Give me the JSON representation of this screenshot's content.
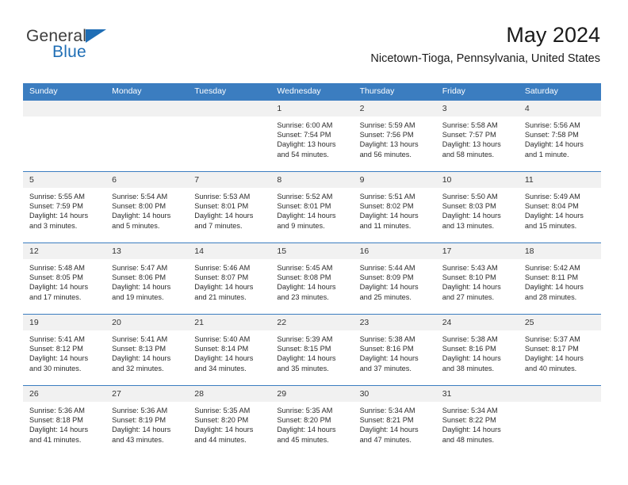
{
  "brand": {
    "name_part1": "General",
    "name_part2": "Blue",
    "logo_icon": "triangle-icon",
    "accent_color": "#1f6eb5"
  },
  "header": {
    "title": "May 2024",
    "subtitle": "Nicetown-Tioga, Pennsylvania, United States"
  },
  "calendar": {
    "header_bg": "#3b7dc0",
    "daynum_bg": "#f1f1f1",
    "weekday_headers": [
      "Sunday",
      "Monday",
      "Tuesday",
      "Wednesday",
      "Thursday",
      "Friday",
      "Saturday"
    ],
    "weeks": [
      [
        {
          "day": "",
          "sunrise": "",
          "sunset": "",
          "daylight1": "",
          "daylight2": "",
          "empty": true
        },
        {
          "day": "",
          "sunrise": "",
          "sunset": "",
          "daylight1": "",
          "daylight2": "",
          "empty": true
        },
        {
          "day": "",
          "sunrise": "",
          "sunset": "",
          "daylight1": "",
          "daylight2": "",
          "empty": true
        },
        {
          "day": "1",
          "sunrise": "Sunrise: 6:00 AM",
          "sunset": "Sunset: 7:54 PM",
          "daylight1": "Daylight: 13 hours",
          "daylight2": "and 54 minutes."
        },
        {
          "day": "2",
          "sunrise": "Sunrise: 5:59 AM",
          "sunset": "Sunset: 7:56 PM",
          "daylight1": "Daylight: 13 hours",
          "daylight2": "and 56 minutes."
        },
        {
          "day": "3",
          "sunrise": "Sunrise: 5:58 AM",
          "sunset": "Sunset: 7:57 PM",
          "daylight1": "Daylight: 13 hours",
          "daylight2": "and 58 minutes."
        },
        {
          "day": "4",
          "sunrise": "Sunrise: 5:56 AM",
          "sunset": "Sunset: 7:58 PM",
          "daylight1": "Daylight: 14 hours",
          "daylight2": "and 1 minute."
        }
      ],
      [
        {
          "day": "5",
          "sunrise": "Sunrise: 5:55 AM",
          "sunset": "Sunset: 7:59 PM",
          "daylight1": "Daylight: 14 hours",
          "daylight2": "and 3 minutes."
        },
        {
          "day": "6",
          "sunrise": "Sunrise: 5:54 AM",
          "sunset": "Sunset: 8:00 PM",
          "daylight1": "Daylight: 14 hours",
          "daylight2": "and 5 minutes."
        },
        {
          "day": "7",
          "sunrise": "Sunrise: 5:53 AM",
          "sunset": "Sunset: 8:01 PM",
          "daylight1": "Daylight: 14 hours",
          "daylight2": "and 7 minutes."
        },
        {
          "day": "8",
          "sunrise": "Sunrise: 5:52 AM",
          "sunset": "Sunset: 8:01 PM",
          "daylight1": "Daylight: 14 hours",
          "daylight2": "and 9 minutes."
        },
        {
          "day": "9",
          "sunrise": "Sunrise: 5:51 AM",
          "sunset": "Sunset: 8:02 PM",
          "daylight1": "Daylight: 14 hours",
          "daylight2": "and 11 minutes."
        },
        {
          "day": "10",
          "sunrise": "Sunrise: 5:50 AM",
          "sunset": "Sunset: 8:03 PM",
          "daylight1": "Daylight: 14 hours",
          "daylight2": "and 13 minutes."
        },
        {
          "day": "11",
          "sunrise": "Sunrise: 5:49 AM",
          "sunset": "Sunset: 8:04 PM",
          "daylight1": "Daylight: 14 hours",
          "daylight2": "and 15 minutes."
        }
      ],
      [
        {
          "day": "12",
          "sunrise": "Sunrise: 5:48 AM",
          "sunset": "Sunset: 8:05 PM",
          "daylight1": "Daylight: 14 hours",
          "daylight2": "and 17 minutes."
        },
        {
          "day": "13",
          "sunrise": "Sunrise: 5:47 AM",
          "sunset": "Sunset: 8:06 PM",
          "daylight1": "Daylight: 14 hours",
          "daylight2": "and 19 minutes."
        },
        {
          "day": "14",
          "sunrise": "Sunrise: 5:46 AM",
          "sunset": "Sunset: 8:07 PM",
          "daylight1": "Daylight: 14 hours",
          "daylight2": "and 21 minutes."
        },
        {
          "day": "15",
          "sunrise": "Sunrise: 5:45 AM",
          "sunset": "Sunset: 8:08 PM",
          "daylight1": "Daylight: 14 hours",
          "daylight2": "and 23 minutes."
        },
        {
          "day": "16",
          "sunrise": "Sunrise: 5:44 AM",
          "sunset": "Sunset: 8:09 PM",
          "daylight1": "Daylight: 14 hours",
          "daylight2": "and 25 minutes."
        },
        {
          "day": "17",
          "sunrise": "Sunrise: 5:43 AM",
          "sunset": "Sunset: 8:10 PM",
          "daylight1": "Daylight: 14 hours",
          "daylight2": "and 27 minutes."
        },
        {
          "day": "18",
          "sunrise": "Sunrise: 5:42 AM",
          "sunset": "Sunset: 8:11 PM",
          "daylight1": "Daylight: 14 hours",
          "daylight2": "and 28 minutes."
        }
      ],
      [
        {
          "day": "19",
          "sunrise": "Sunrise: 5:41 AM",
          "sunset": "Sunset: 8:12 PM",
          "daylight1": "Daylight: 14 hours",
          "daylight2": "and 30 minutes."
        },
        {
          "day": "20",
          "sunrise": "Sunrise: 5:41 AM",
          "sunset": "Sunset: 8:13 PM",
          "daylight1": "Daylight: 14 hours",
          "daylight2": "and 32 minutes."
        },
        {
          "day": "21",
          "sunrise": "Sunrise: 5:40 AM",
          "sunset": "Sunset: 8:14 PM",
          "daylight1": "Daylight: 14 hours",
          "daylight2": "and 34 minutes."
        },
        {
          "day": "22",
          "sunrise": "Sunrise: 5:39 AM",
          "sunset": "Sunset: 8:15 PM",
          "daylight1": "Daylight: 14 hours",
          "daylight2": "and 35 minutes."
        },
        {
          "day": "23",
          "sunrise": "Sunrise: 5:38 AM",
          "sunset": "Sunset: 8:16 PM",
          "daylight1": "Daylight: 14 hours",
          "daylight2": "and 37 minutes."
        },
        {
          "day": "24",
          "sunrise": "Sunrise: 5:38 AM",
          "sunset": "Sunset: 8:16 PM",
          "daylight1": "Daylight: 14 hours",
          "daylight2": "and 38 minutes."
        },
        {
          "day": "25",
          "sunrise": "Sunrise: 5:37 AM",
          "sunset": "Sunset: 8:17 PM",
          "daylight1": "Daylight: 14 hours",
          "daylight2": "and 40 minutes."
        }
      ],
      [
        {
          "day": "26",
          "sunrise": "Sunrise: 5:36 AM",
          "sunset": "Sunset: 8:18 PM",
          "daylight1": "Daylight: 14 hours",
          "daylight2": "and 41 minutes."
        },
        {
          "day": "27",
          "sunrise": "Sunrise: 5:36 AM",
          "sunset": "Sunset: 8:19 PM",
          "daylight1": "Daylight: 14 hours",
          "daylight2": "and 43 minutes."
        },
        {
          "day": "28",
          "sunrise": "Sunrise: 5:35 AM",
          "sunset": "Sunset: 8:20 PM",
          "daylight1": "Daylight: 14 hours",
          "daylight2": "and 44 minutes."
        },
        {
          "day": "29",
          "sunrise": "Sunrise: 5:35 AM",
          "sunset": "Sunset: 8:20 PM",
          "daylight1": "Daylight: 14 hours",
          "daylight2": "and 45 minutes."
        },
        {
          "day": "30",
          "sunrise": "Sunrise: 5:34 AM",
          "sunset": "Sunset: 8:21 PM",
          "daylight1": "Daylight: 14 hours",
          "daylight2": "and 47 minutes."
        },
        {
          "day": "31",
          "sunrise": "Sunrise: 5:34 AM",
          "sunset": "Sunset: 8:22 PM",
          "daylight1": "Daylight: 14 hours",
          "daylight2": "and 48 minutes."
        },
        {
          "day": "",
          "sunrise": "",
          "sunset": "",
          "daylight1": "",
          "daylight2": "",
          "empty": true
        }
      ]
    ]
  }
}
